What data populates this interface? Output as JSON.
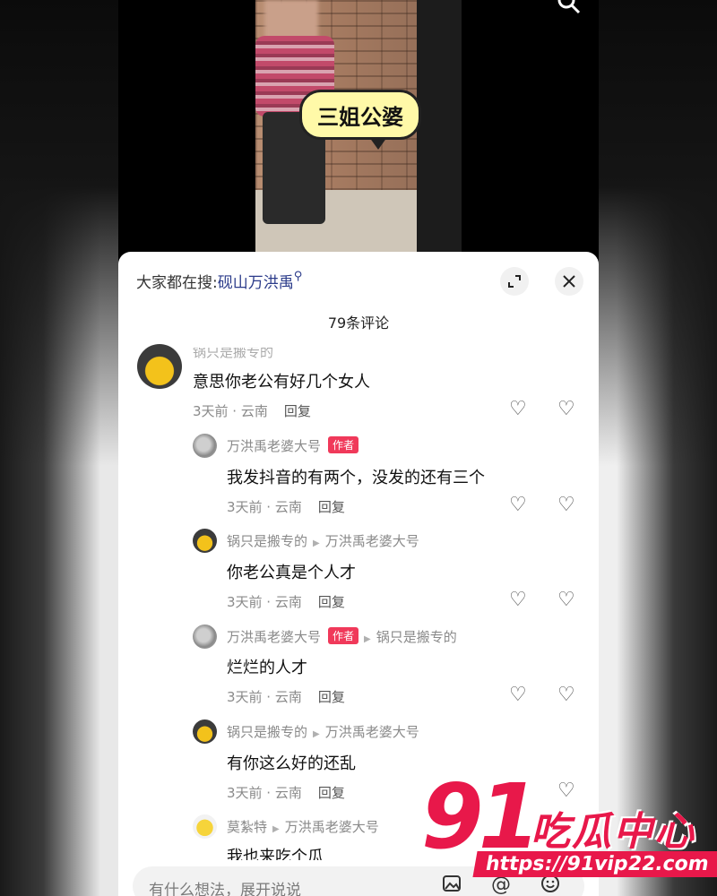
{
  "video": {
    "bubble_text": "三姐公婆"
  },
  "sheet": {
    "search_prefix": "大家都在搜:",
    "search_term": "砚山万洪禹",
    "comment_count": "79条评论"
  },
  "comments": [
    {
      "name": "锅只是搬专的",
      "text": "意思你老公有好几个女人",
      "time": "3天前 · 云南",
      "reply": "回复"
    },
    {
      "name": "万洪禹老婆大号",
      "badge": "作者",
      "text": "我发抖音的有两个，没发的还有三个",
      "time": "3天前 · 云南",
      "reply": "回复"
    },
    {
      "name": "锅只是搬专的",
      "to": "万洪禹老婆大号",
      "text": "你老公真是个人才",
      "time": "3天前 · 云南",
      "reply": "回复"
    },
    {
      "name": "万洪禹老婆大号",
      "badge": "作者",
      "to": "锅只是搬专的",
      "text": "烂烂的人才",
      "time": "3天前 · 云南",
      "reply": "回复"
    },
    {
      "name": "锅只是搬专的",
      "to": "万洪禹老婆大号",
      "text": "有你这么好的还乱",
      "time": "3天前 · 云南",
      "reply": "回复"
    },
    {
      "name": "莫紮特",
      "to": "万洪禹老婆大号",
      "text": "我也来吃个瓜"
    }
  ],
  "input": {
    "placeholder": "有什么想法，展开说说"
  },
  "watermark": {
    "num": "91",
    "cn": "吃瓜中心",
    "url": "https://91vip22.com"
  },
  "icons": [
    "search-icon",
    "expand-icon",
    "close-icon",
    "heart-icon",
    "broken-heart-icon",
    "image-icon",
    "at-icon",
    "emoji-icon"
  ]
}
